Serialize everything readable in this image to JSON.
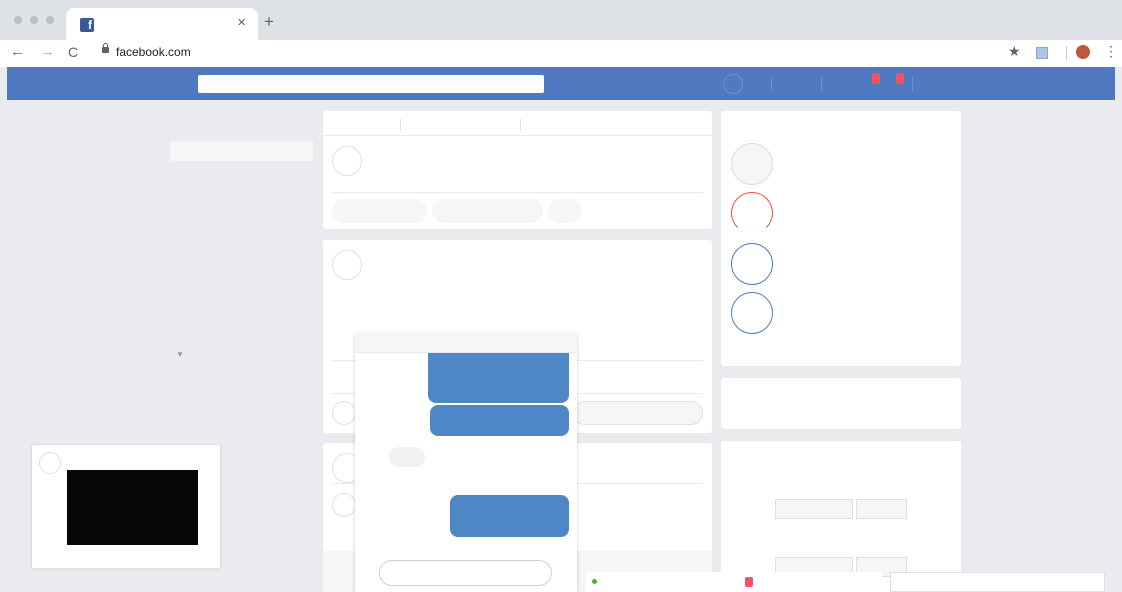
{
  "browser": {
    "tab": {
      "close_label": "×",
      "new_tab_label": "+"
    },
    "nav": {
      "back": "←",
      "forward": "→",
      "reload": "C"
    },
    "url": "facebook.com",
    "icons": {
      "star": "★",
      "menu": "⋮"
    },
    "favicon_letter": "f"
  },
  "colors": {
    "brand": "#4f79c1",
    "bubble": "#4f86c6",
    "notification": "#f25268",
    "story_red": "#f04c3c",
    "story_blue": "#4a7bc0"
  },
  "sidebar": {
    "dropdown_icon": "▼"
  },
  "chat_status": "online"
}
